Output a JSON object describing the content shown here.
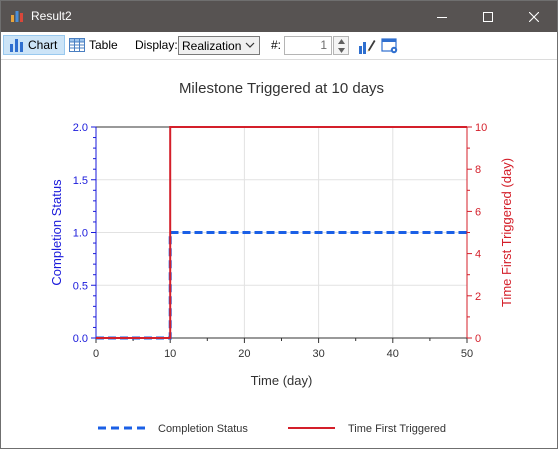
{
  "window": {
    "title": "Result2"
  },
  "toolbar": {
    "chart_label": "Chart",
    "table_label": "Table",
    "display_label": "Display:",
    "display_value": "Realization",
    "number_label": "#:",
    "number_value": "1"
  },
  "chart_data": {
    "type": "line",
    "title": "Milestone Triggered at 10 days",
    "xlabel": "Time (day)",
    "ylabel_left": "Completion Status",
    "ylabel_right": "Time First Triggered (day)",
    "xlim": [
      0,
      50
    ],
    "ylim_left": [
      0,
      2
    ],
    "ylim_right": [
      0,
      10
    ],
    "x_ticks": [
      "0",
      "10",
      "20",
      "30",
      "40",
      "50"
    ],
    "y_left_ticks": [
      "0.0",
      "0.5",
      "1.0",
      "1.5",
      "2.0"
    ],
    "y_right_ticks": [
      "0",
      "2",
      "4",
      "6",
      "8",
      "10"
    ],
    "grid": true,
    "legend_position": "bottom",
    "series": [
      {
        "name": "Completion Status",
        "axis": "left",
        "style": "dashed",
        "color": "#1a5fe6",
        "x": [
          0,
          10,
          10,
          50
        ],
        "y": [
          0,
          0,
          1,
          1
        ]
      },
      {
        "name": "Time First Triggered",
        "axis": "right",
        "style": "solid",
        "color": "#d41f2a",
        "x": [
          0,
          10,
          10,
          50
        ],
        "y": [
          0,
          0,
          10,
          10
        ]
      }
    ]
  }
}
